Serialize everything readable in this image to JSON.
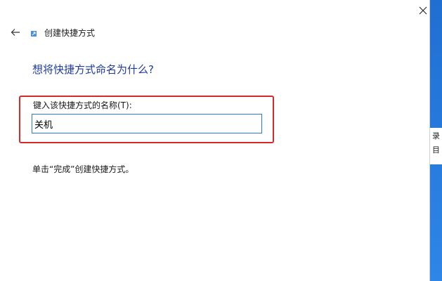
{
  "dialog": {
    "title": "创建快捷方式",
    "heading": "想将快捷方式命名为什么?",
    "field_label": "键入该快捷方式的名称(T):",
    "field_value": "关机",
    "hint": "单击“完成”创建快捷方式。"
  },
  "icons": {
    "back": "back-arrow-icon",
    "close": "close-icon",
    "title": "shortcut-icon"
  },
  "background_glyphs": [
    "录",
    "目"
  ],
  "colors": {
    "heading": "#1f3b9b",
    "highlight_box": "#d42a2a",
    "input_border": "#2b7bd0",
    "desktop_blue": "#1f6fd1"
  }
}
